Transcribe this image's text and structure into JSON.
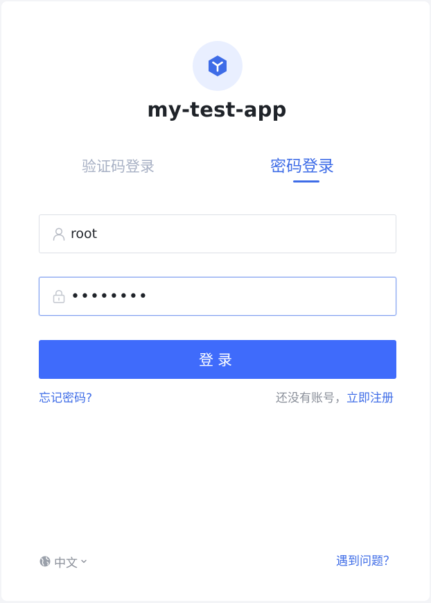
{
  "app": {
    "title": "my-test-app",
    "logo_icon": "cube-icon"
  },
  "tabs": [
    {
      "label": "验证码登录",
      "active": false
    },
    {
      "label": "密码登录",
      "active": true
    }
  ],
  "form": {
    "username": {
      "value": "root",
      "icon": "user-icon"
    },
    "password": {
      "value": "password",
      "icon": "lock-icon"
    },
    "submit_label": "登录"
  },
  "links": {
    "forgot": "忘记密码?",
    "no_account": "还没有账号，",
    "register": "立即注册"
  },
  "footer": {
    "language": "中文",
    "language_icon": "globe-icon",
    "help": "遇到问题？"
  },
  "colors": {
    "primary": "#3f6bfb",
    "link": "#3e6ce7",
    "tab_inactive": "#a7b0c4",
    "logo_bg": "#e9efff"
  }
}
